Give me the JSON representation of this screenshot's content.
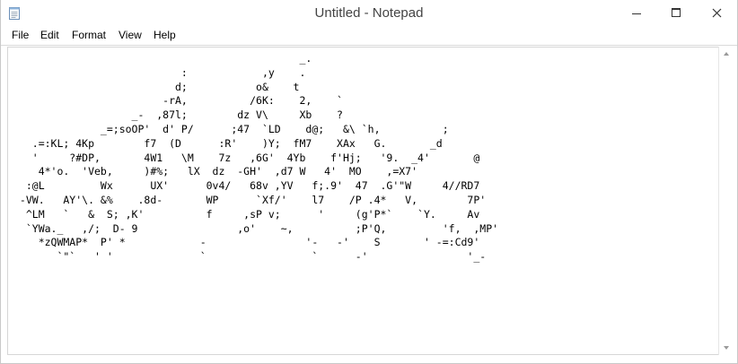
{
  "window": {
    "title": "Untitled - Notepad",
    "app_icon": "notepad-icon",
    "controls": [
      "minimize-icon",
      "maximize-icon",
      "close-icon"
    ]
  },
  "menu": {
    "file": "File",
    "edit": "Edit",
    "format": "Format",
    "view": "View",
    "help": "Help"
  },
  "editor": {
    "content": "                                              _.\n                           :            ,y    .\n                          d;           o&    t\n                        -rA,          /6K:    2,    `\n                   _-  ,87l;        dz V\\     Xb    ?\n              _=;soOP'  d' P/      ;47  `LD    d@;   &\\ `h,          ;\n   .=:KL; 4Kp        f7  (D      :R'    )Y;  fM7    XAx   G.       _d\n   '     ?#DP,       4W1   \\M    7z   ,6G'  4Yb    f'Hj;   '9.  _4'       @\n    4*'o.  'Veb,     )#%;   lX  dz  -GH'  ,d7 W   4'  MO    ,=X7'\n  :@L         Wx      UX'      0v4/   68v ,YV   f;.9'  47  .G'\"W     4//RD7\n -VW.   AY'\\. &%    .8d-       WP      `Xf/'    l7    /P .4*   V,        7P'\n  ^LM   `   &  S; ,K'          f     ,sP v;      '     (g'P*`    `Y.     Av\n  `YWa._   ,/;  D- 9                ,o'    ~,          ;P'Q,         'f,  ,MP'\n    *zQWMAP*  P' *            -                '-   -'    S       ' -=:Cd9'\n       `\"`   ' '              `                 `      -'                '_-"
  },
  "scrollbar": {
    "up": "scroll-up-arrow-icon",
    "down": "scroll-down-arrow-icon"
  }
}
